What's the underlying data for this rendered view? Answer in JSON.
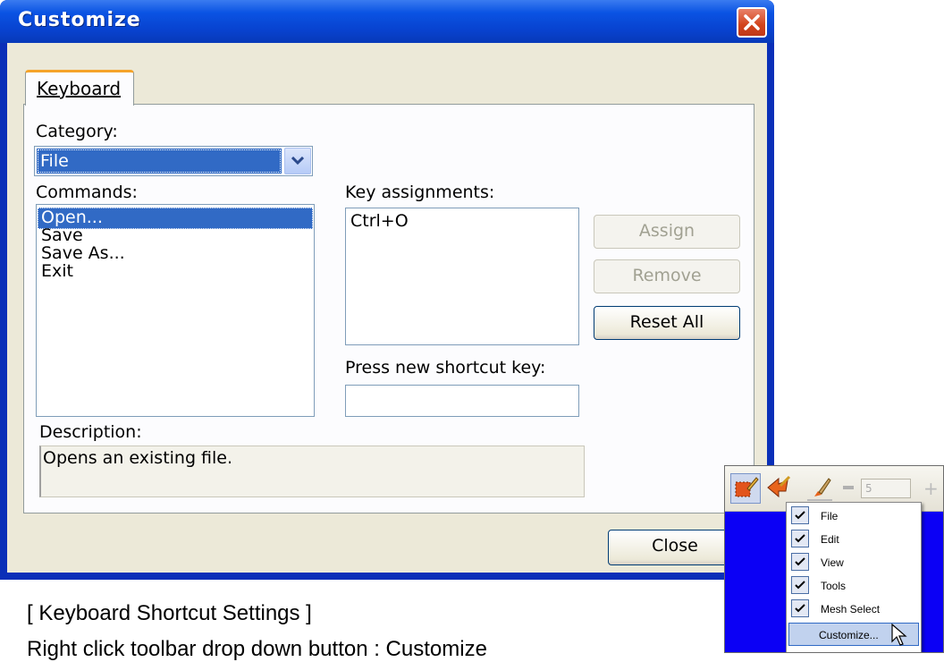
{
  "dialog": {
    "title": "Customize",
    "tab": "Keyboard",
    "category_label": "Category:",
    "category_value": "File",
    "commands_label": "Commands:",
    "commands": [
      "Open...",
      "Save",
      "Save As...",
      "Exit"
    ],
    "selected_command_index": 0,
    "key_assignments_label": "Key assignments:",
    "key_assignments": [
      "Ctrl+O"
    ],
    "press_shortcut_label": "Press new shortcut key:",
    "press_shortcut_value": "",
    "buttons": {
      "assign": "Assign",
      "remove": "Remove",
      "reset_all": "Reset All",
      "close": "Close"
    },
    "description_label": "Description:",
    "description": "Opens an existing file."
  },
  "caption": {
    "title": "[  Keyboard Shortcut Settings  ]",
    "subtitle": "Right click toolbar drop down button : Customize"
  },
  "inset": {
    "toolbar_value": "5",
    "menu_items": [
      {
        "label": "File",
        "checked": true
      },
      {
        "label": "Edit",
        "checked": true
      },
      {
        "label": "View",
        "checked": true
      },
      {
        "label": "Tools",
        "checked": true
      },
      {
        "label": "Mesh Select",
        "checked": true
      }
    ],
    "customize_label": "Customize..."
  },
  "colors": {
    "titlebar": "#0a53e3",
    "selection": "#316ac5",
    "dialog_face": "#ece9d8",
    "inset_background": "#0b00f5"
  }
}
